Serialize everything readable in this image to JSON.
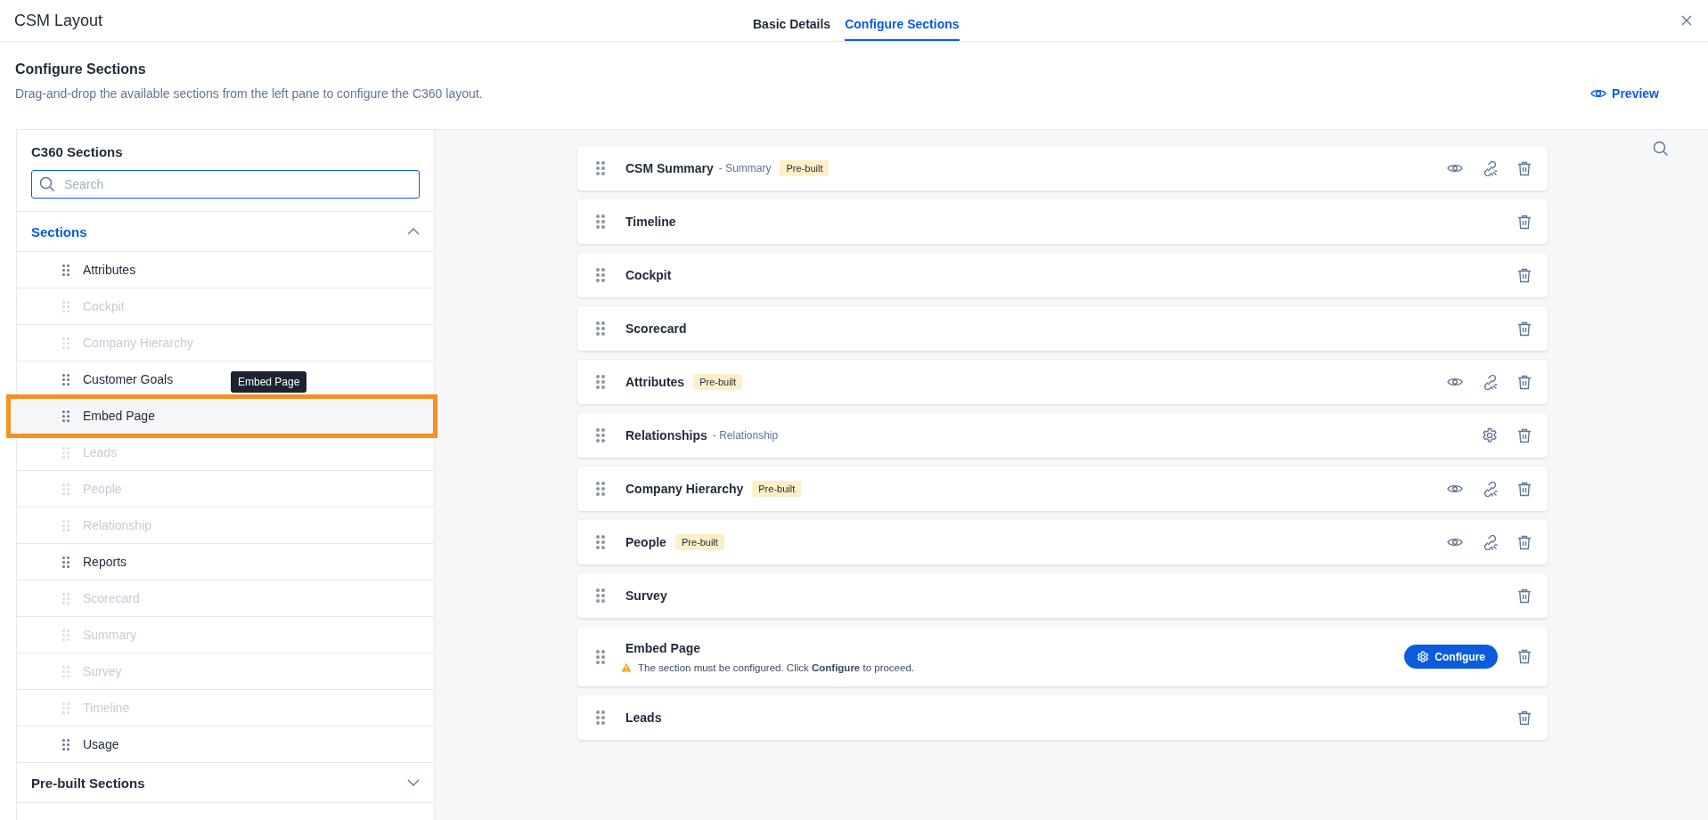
{
  "window": {
    "title": "CSM Layout"
  },
  "tabs": [
    {
      "label": "Basic Details",
      "selected": false
    },
    {
      "label": "Configure Sections",
      "selected": true
    }
  ],
  "page": {
    "heading": "Configure Sections",
    "description": "Drag-and-drop the available sections from the left pane to configure the C360 layout.",
    "preview_label": "Preview"
  },
  "left_pane": {
    "title": "C360 Sections",
    "search": {
      "placeholder": "Search"
    },
    "groups": [
      {
        "label": "Sections",
        "expanded": true,
        "items": [
          {
            "label": "Attributes",
            "disabled": false,
            "highlighted": false
          },
          {
            "label": "Cockpit",
            "disabled": true,
            "highlighted": false
          },
          {
            "label": "Company Hierarchy",
            "disabled": true,
            "highlighted": false
          },
          {
            "label": "Customer Goals",
            "disabled": false,
            "highlighted": false
          },
          {
            "label": "Embed Page",
            "disabled": false,
            "highlighted": true,
            "tooltip": "Embed Page"
          },
          {
            "label": "Leads",
            "disabled": true,
            "highlighted": false
          },
          {
            "label": "People",
            "disabled": true,
            "highlighted": false
          },
          {
            "label": "Relationship",
            "disabled": true,
            "highlighted": false
          },
          {
            "label": "Reports",
            "disabled": false,
            "highlighted": false
          },
          {
            "label": "Scorecard",
            "disabled": true,
            "highlighted": false
          },
          {
            "label": "Summary",
            "disabled": true,
            "highlighted": false
          },
          {
            "label": "Survey",
            "disabled": true,
            "highlighted": false
          },
          {
            "label": "Timeline",
            "disabled": true,
            "highlighted": false
          },
          {
            "label": "Usage",
            "disabled": false,
            "highlighted": false
          }
        ]
      },
      {
        "label": "Pre-built Sections",
        "expanded": false
      }
    ]
  },
  "layout_sections": [
    {
      "name": "CSM Summary",
      "subtitle": "- Summary",
      "badge": "Pre-built",
      "actions": [
        {
          "kind": "preview"
        },
        {
          "kind": "unlink"
        },
        {
          "kind": "delete"
        }
      ]
    },
    {
      "name": "Timeline",
      "actions": [
        {
          "kind": "delete"
        }
      ]
    },
    {
      "name": "Cockpit",
      "actions": [
        {
          "kind": "delete"
        }
      ]
    },
    {
      "name": "Scorecard",
      "actions": [
        {
          "kind": "delete"
        }
      ]
    },
    {
      "name": "Attributes",
      "badge": "Pre-built",
      "actions": [
        {
          "kind": "preview"
        },
        {
          "kind": "unlink"
        },
        {
          "kind": "delete"
        }
      ]
    },
    {
      "name": "Relationships",
      "subtitle": "- Relationship",
      "actions": [
        {
          "kind": "settings"
        },
        {
          "kind": "delete"
        }
      ]
    },
    {
      "name": "Company Hierarchy",
      "badge": "Pre-built",
      "actions": [
        {
          "kind": "preview"
        },
        {
          "kind": "unlink"
        },
        {
          "kind": "delete"
        }
      ]
    },
    {
      "name": "People",
      "badge": "Pre-built",
      "actions": [
        {
          "kind": "preview"
        },
        {
          "kind": "unlink"
        },
        {
          "kind": "delete"
        }
      ]
    },
    {
      "name": "Survey",
      "actions": [
        {
          "kind": "delete"
        }
      ]
    },
    {
      "name": "Embed Page",
      "warning": "The section must be configured. Click **Configure** to proceed.",
      "actions": [
        {
          "kind": "configure",
          "label": "Configure"
        },
        {
          "kind": "delete"
        }
      ]
    },
    {
      "name": "Leads",
      "actions": [
        {
          "kind": "delete"
        }
      ]
    }
  ]
}
